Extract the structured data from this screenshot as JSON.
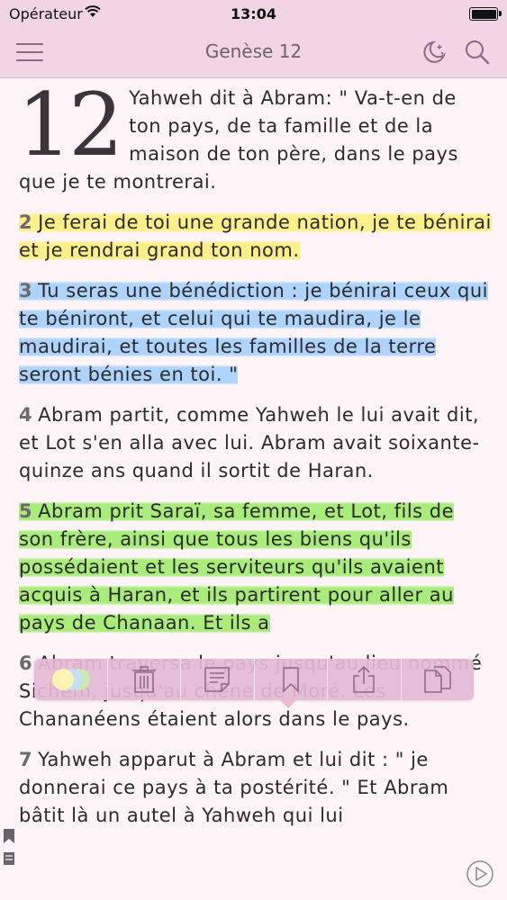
{
  "status_bar": {
    "carrier": "Opérateur",
    "time": "13:04"
  },
  "nav": {
    "title": "Genèse 12",
    "icons": [
      "menu-icon",
      "night-mode-icon",
      "search-icon"
    ]
  },
  "chapter": {
    "number": "12",
    "verses": [
      {
        "num": "",
        "text": "Yahweh dit à Abram: \" Va-t-en de ton pays, de ta famille et de la maison de ton père, dans le pays que je te montrerai.",
        "highlight": "none"
      },
      {
        "num": "2",
        "text": "Je ferai de toi une grande nation, je te bénirai et je rendrai grand ton nom.",
        "highlight": "#ffee78"
      },
      {
        "num": "3",
        "text": "Tu seras une bénédiction : je bénirai ceux qui te béniront, et celui qui te maudira, je le maudirai, et toutes les familles de la terre seront bénies en toi. \"",
        "highlight": "#a0cdff"
      },
      {
        "num": "4",
        "text": "Abram partit, comme Yahweh le lui avait dit, et Lot s'en alla avec lui. Abram avait soixante-quinze ans quand il sortit de Haran.",
        "highlight": "none"
      },
      {
        "num": "5",
        "text": "Abram prit Saraï, sa femme, et Lot, fils de son frère, ainsi que tous les biens qu'ils possédaient et les serviteurs qu'ils avaient acquis à Haran, et ils partirent pour aller au pays de Chanaan. Et ils a",
        "highlight": "#a0eb6e"
      },
      {
        "num": "6",
        "text": "Abram traversa le pays jusqu'au lieu nommé Sichem, jusqu'au chêne de Moré. Les Chananéens étaient alors dans le pays.",
        "highlight": "none"
      },
      {
        "num": "7",
        "text": "Yahweh apparut à Abram et lui dit : \" je donnerai ce pays à ta postérité. \" Et Abram bâtit là un autel à Yahweh qui lui",
        "highlight": "none"
      }
    ]
  },
  "toolbar": {
    "items": [
      "color-picker-icon",
      "trash-icon",
      "note-icon",
      "bookmark-icon",
      "share-icon",
      "copy-icon"
    ]
  },
  "side_icons": [
    "bookmark-marker-icon",
    "note-marker-icon"
  ],
  "audio": {
    "icon": "play-icon"
  }
}
